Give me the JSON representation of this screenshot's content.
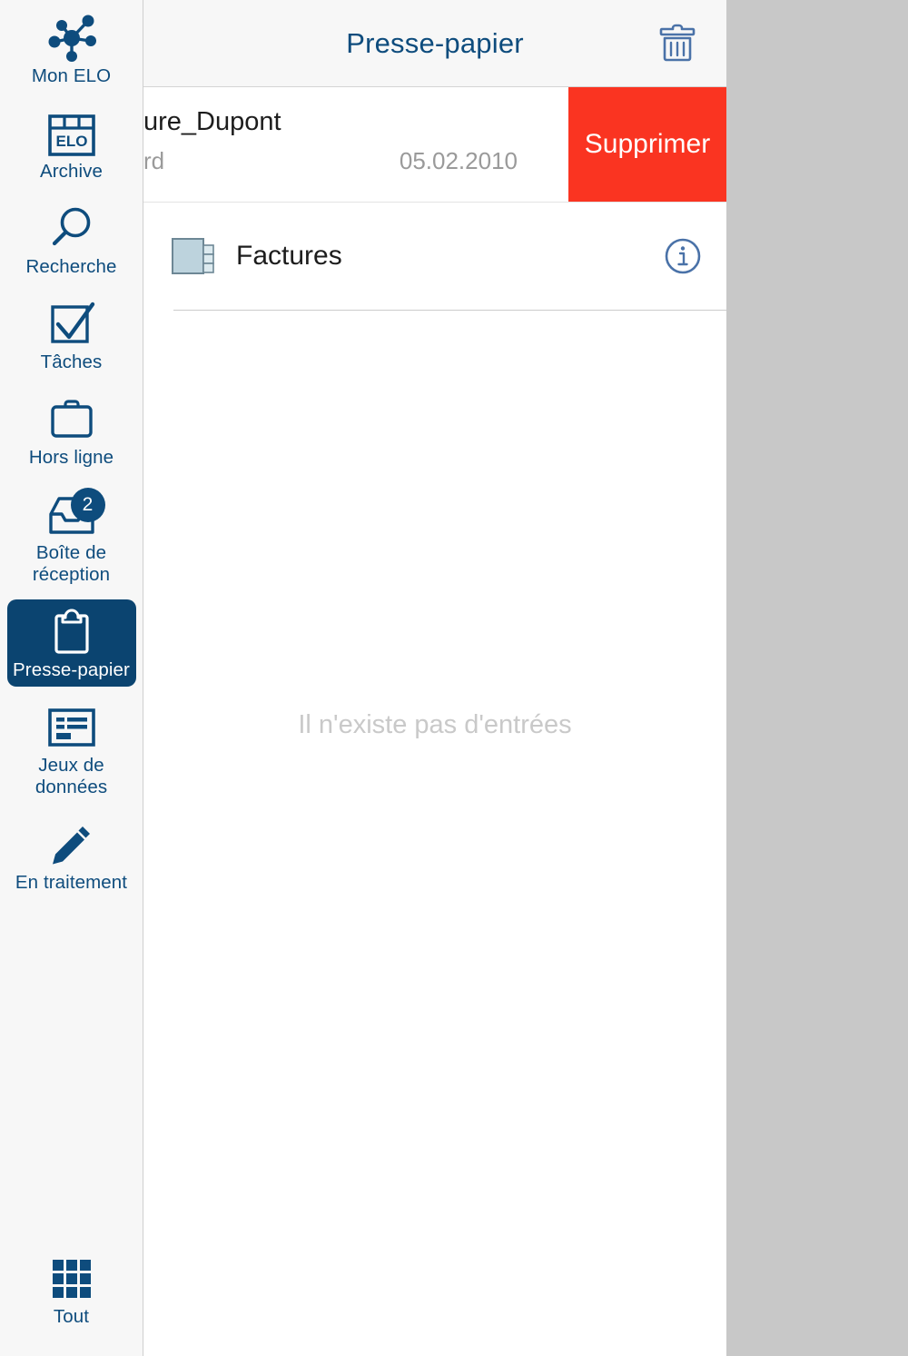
{
  "colors": {
    "brand_blue": "#0e4c7d",
    "selected_bg": "#0b4470",
    "delete_red": "#fa3421",
    "sidebar_bg": "#f7f7f7",
    "canvas_gray": "#c8c8c8",
    "muted_text": "#9a9a9a",
    "empty_text": "#c9c9c9",
    "folder_fill": "#bdd3dd"
  },
  "sidebar": {
    "items": [
      {
        "label": "Mon ELO",
        "icon": "network-nodes-icon",
        "selected": false,
        "badge": null
      },
      {
        "label": "Archive",
        "icon": "elo-archive-icon",
        "selected": false,
        "badge": null
      },
      {
        "label": "Recherche",
        "icon": "search-icon",
        "selected": false,
        "badge": null
      },
      {
        "label": "Tâches",
        "icon": "checkbox-check-icon",
        "selected": false,
        "badge": null
      },
      {
        "label": "Hors ligne",
        "icon": "briefcase-icon",
        "selected": false,
        "badge": null
      },
      {
        "label": "Boîte de\nréception",
        "icon": "inbox-tray-icon",
        "selected": false,
        "badge": "2"
      },
      {
        "label": "Presse-papier",
        "icon": "clipboard-icon",
        "selected": true,
        "badge": null
      },
      {
        "label": "Jeux de\ndonnées",
        "icon": "data-record-icon",
        "selected": false,
        "badge": null
      },
      {
        "label": "En traitement",
        "icon": "pencil-icon",
        "selected": false,
        "badge": null
      }
    ],
    "bottom": {
      "label": "Tout",
      "icon": "grid-apps-icon"
    }
  },
  "topbar": {
    "title": "Presse-papier",
    "delete_icon": "trash-icon"
  },
  "list": {
    "swiped_row": {
      "title": "ure_Dupont",
      "subtitle": "rd",
      "date": "05.02.2010",
      "action_label": "Supprimer"
    },
    "entries": [
      {
        "label": "Factures",
        "icon": "folder-tab-icon",
        "info_icon": "info-circle-icon"
      }
    ]
  },
  "empty_state": {
    "message": "Il n'existe pas d'entrées"
  }
}
